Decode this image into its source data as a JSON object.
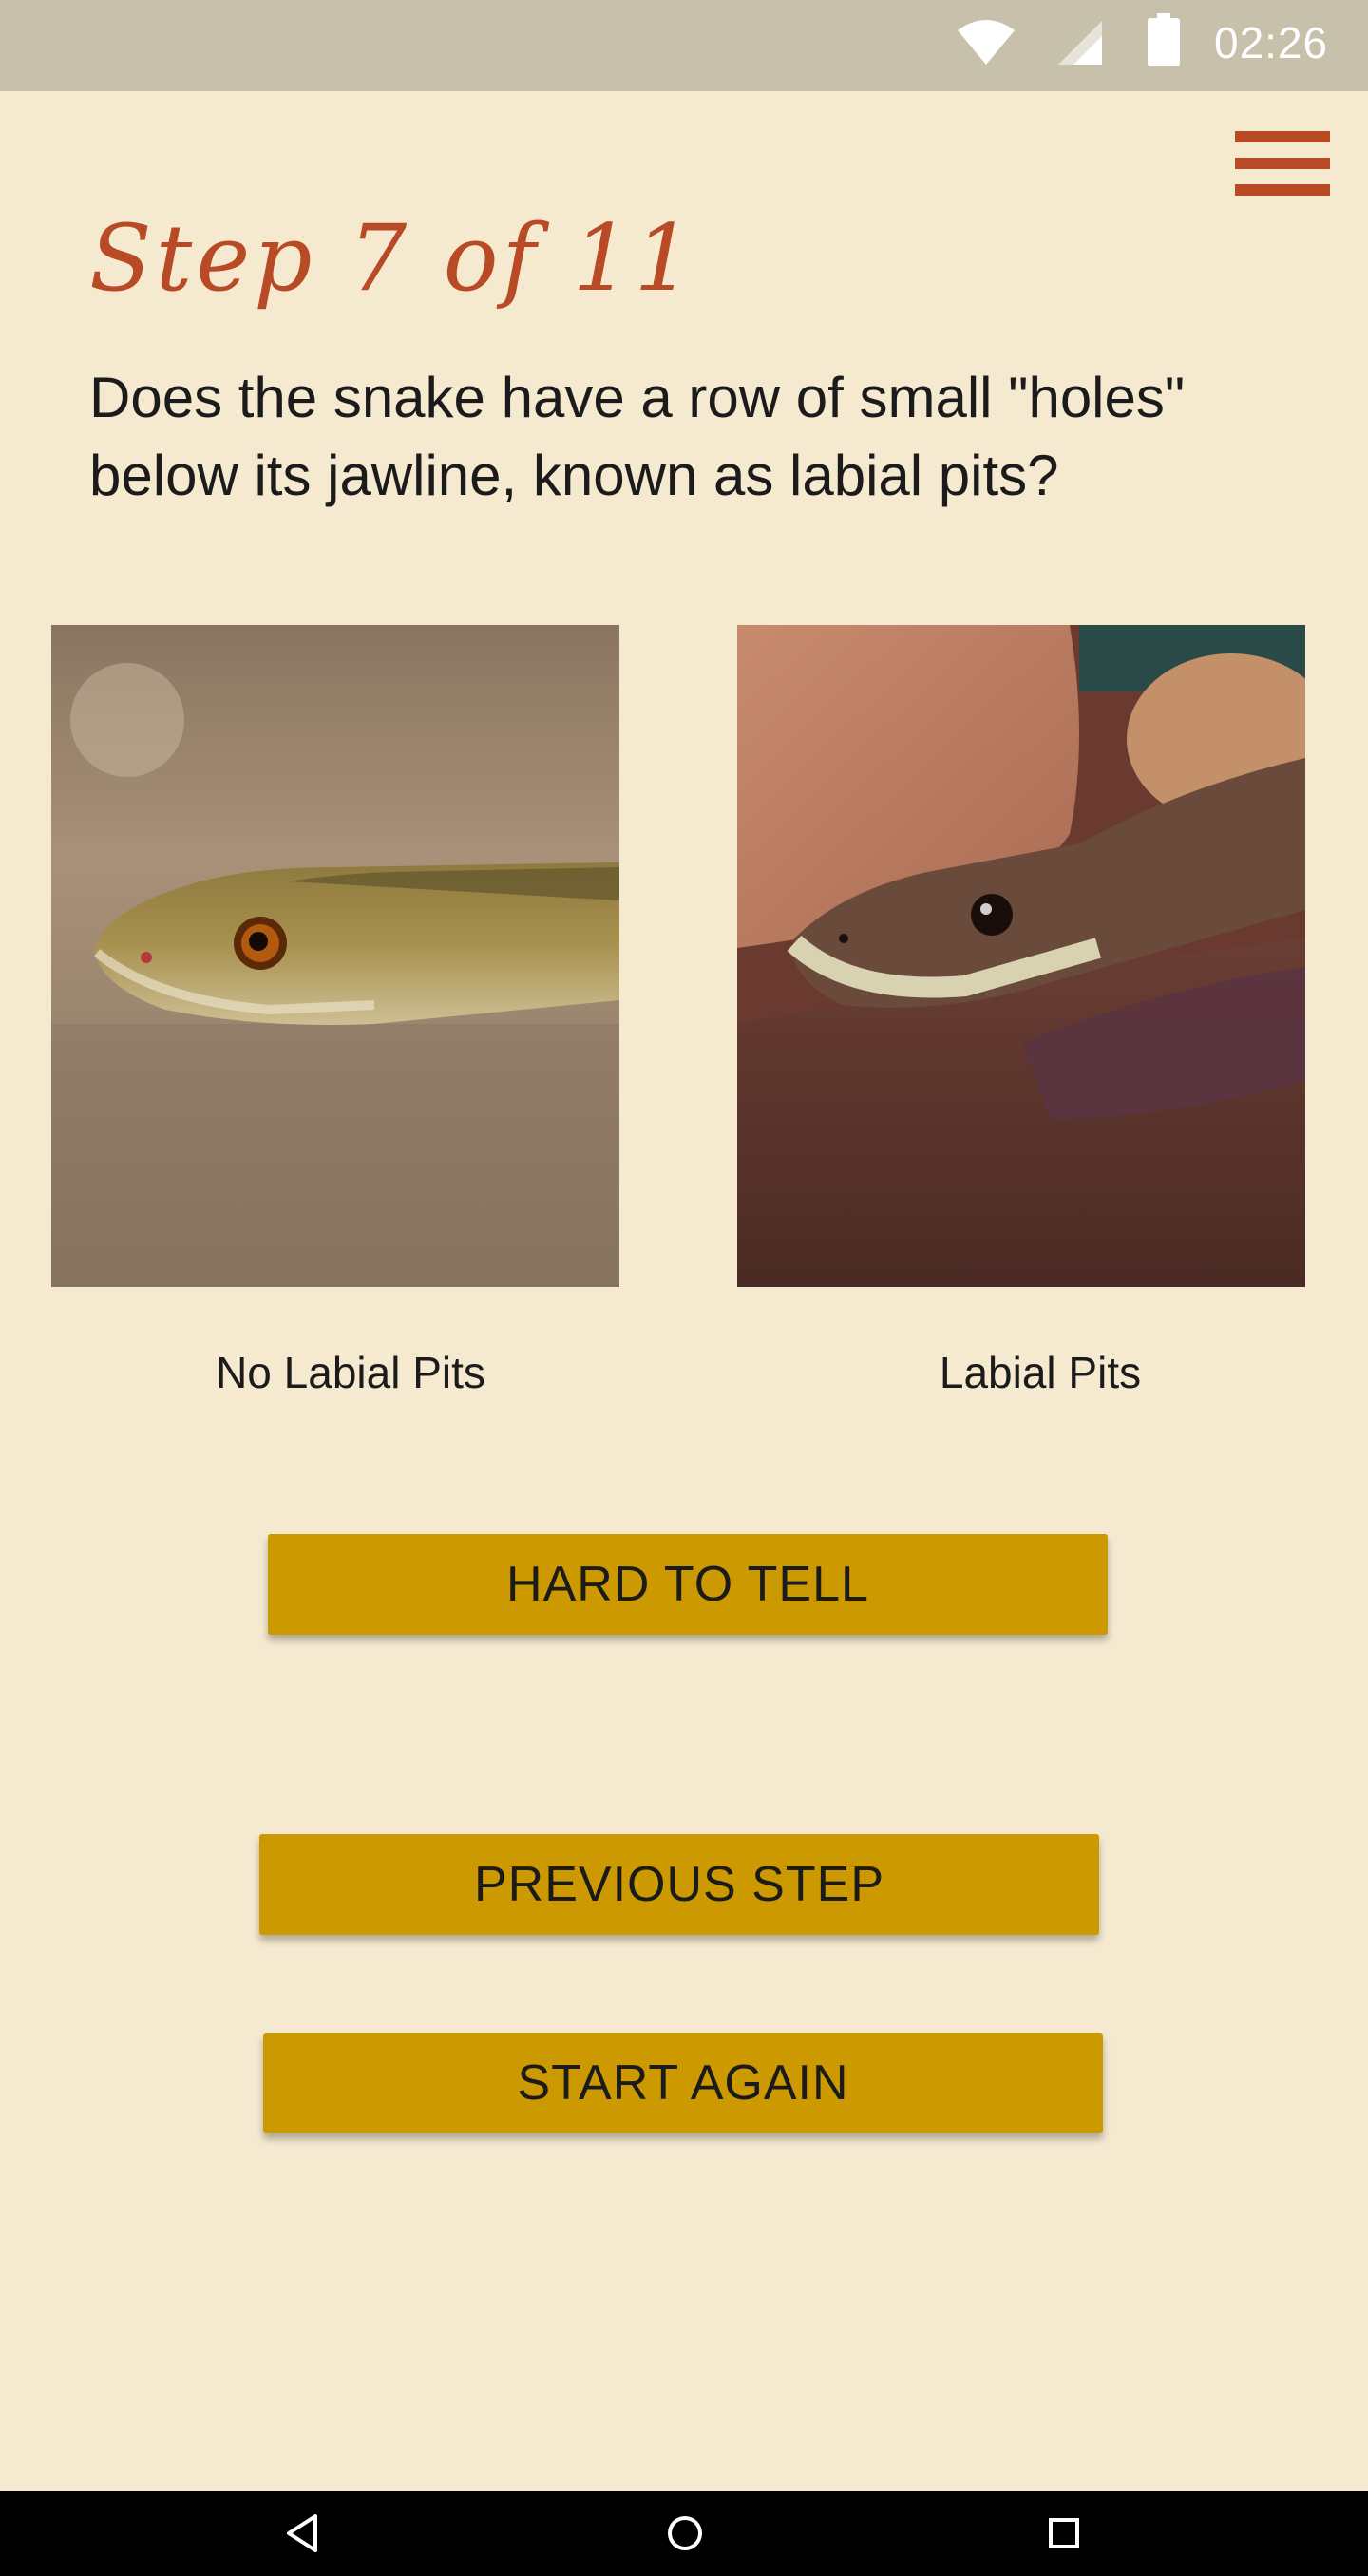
{
  "status_bar": {
    "time": "02:26",
    "icons": [
      "wifi-icon",
      "signal-icon",
      "battery-icon"
    ]
  },
  "header": {
    "menu_icon": "hamburger-menu-icon",
    "step_title": "Step 7 of 11"
  },
  "question": "Does the snake have a row of small \"holes\" below its jawline, known as labial pits?",
  "options": [
    {
      "caption": "No Labial Pits",
      "image": "brown-snake-photo"
    },
    {
      "caption": "Labial Pits",
      "image": "python-photo"
    }
  ],
  "buttons": {
    "hard_to_tell": "HARD TO TELL",
    "previous_step": "PREVIOUS STEP",
    "start_again": "START AGAIN"
  },
  "nav_bar": {
    "icons": [
      "back-icon",
      "home-icon",
      "recents-icon"
    ]
  },
  "colors": {
    "background": "#f5ead0",
    "accent": "#b84a25",
    "button": "#cc9900",
    "status_bar": "#c7c0aa"
  }
}
